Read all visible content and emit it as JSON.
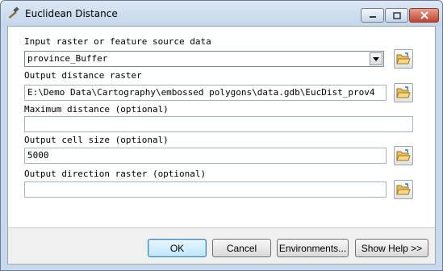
{
  "window": {
    "title": "Euclidean Distance",
    "icon": "hammer-tool-icon"
  },
  "fields": {
    "input_raster": {
      "label": "Input raster or feature source data",
      "value": "province_Buffer",
      "icon": "folder-open-icon"
    },
    "output_distance": {
      "label": "Output distance raster",
      "value": "E:\\Demo Data\\Cartography\\embossed polygons\\data.gdb\\EucDist_prov4",
      "icon": "folder-open-icon"
    },
    "max_distance": {
      "label": "Maximum distance (optional)",
      "value": ""
    },
    "cell_size": {
      "label": "Output cell size (optional)",
      "value": "5000",
      "icon": "folder-open-icon"
    },
    "direction_raster": {
      "label": "Output direction raster (optional)",
      "value": "",
      "icon": "folder-open-icon"
    }
  },
  "buttons": {
    "ok": "OK",
    "cancel": "Cancel",
    "environments": "Environments...",
    "show_help": "Show Help >>"
  }
}
